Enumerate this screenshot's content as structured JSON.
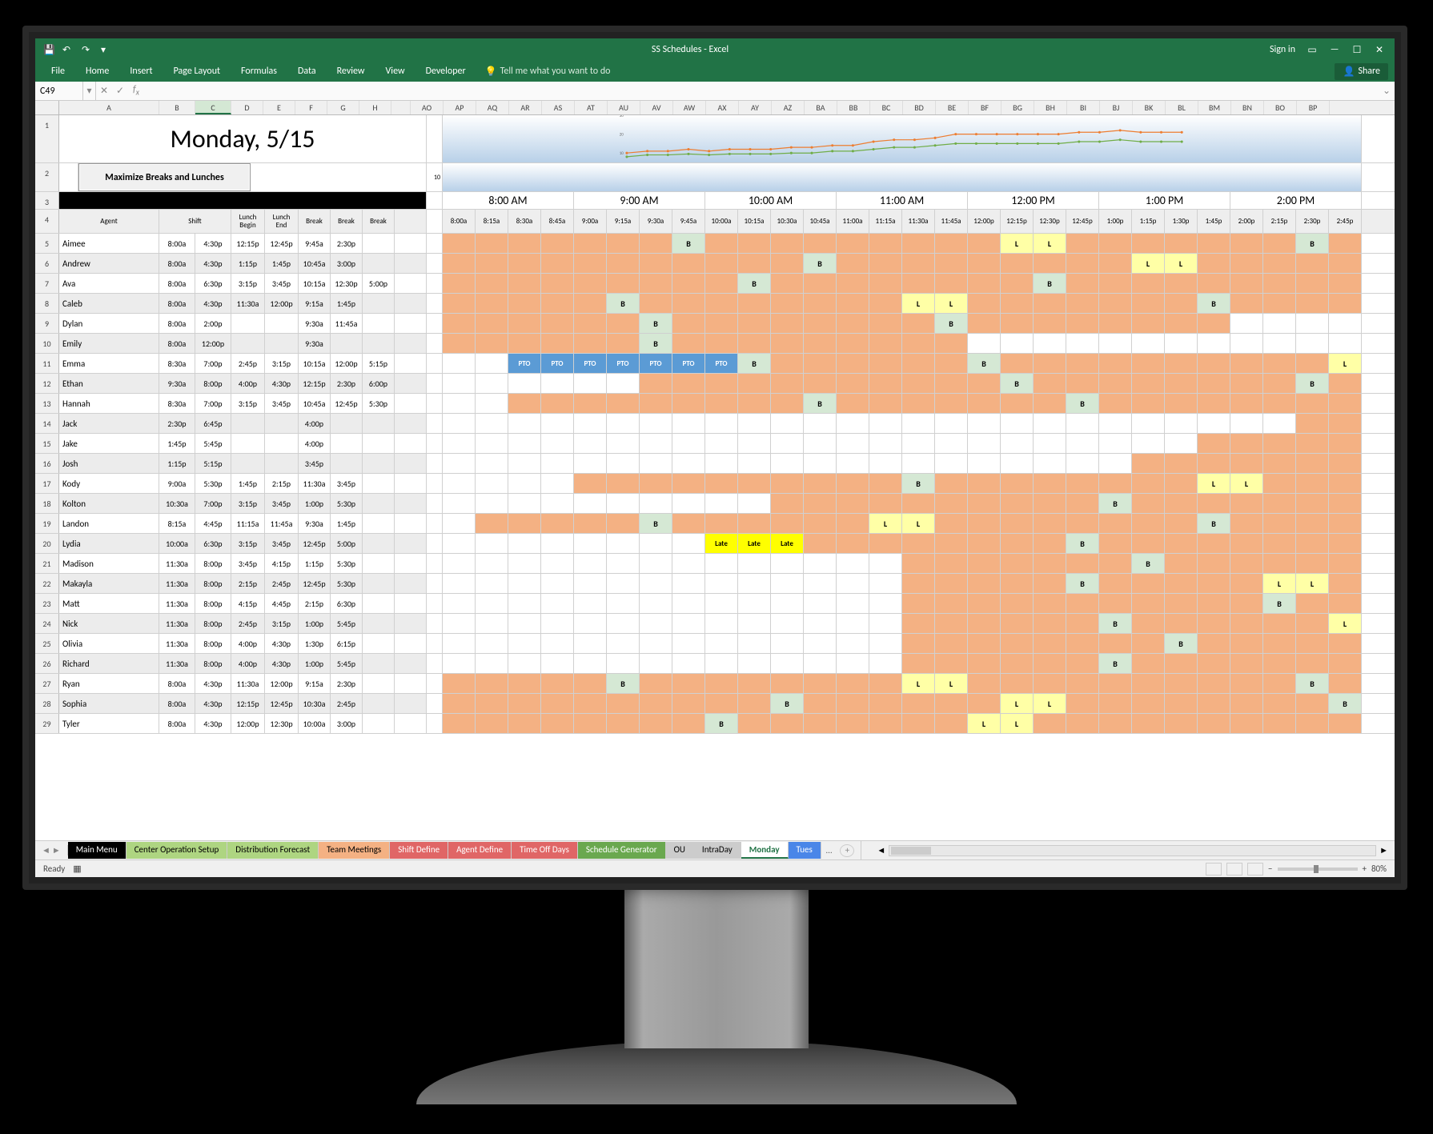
{
  "app": {
    "title": "SS Schedules - Excel",
    "sign_in": "Sign in",
    "share": "Share",
    "tell_me": "Tell me what you want to do"
  },
  "ribbon": {
    "tabs": [
      "File",
      "Home",
      "Insert",
      "Page Layout",
      "Formulas",
      "Data",
      "Review",
      "View",
      "Developer"
    ]
  },
  "name_box": "C49",
  "status": {
    "ready": "Ready",
    "zoom": "80%"
  },
  "columns_left": [
    "A",
    "B",
    "C",
    "D",
    "E",
    "F",
    "G",
    "H"
  ],
  "columns_right": [
    "AO",
    "AP",
    "AQ",
    "AR",
    "AS",
    "AT",
    "AU",
    "AV",
    "AW",
    "AX",
    "AY",
    "AZ",
    "BA",
    "BB",
    "BC",
    "BD",
    "BE",
    "BF",
    "BG",
    "BH",
    "BI",
    "BJ",
    "BK",
    "BL",
    "BM",
    "BN",
    "BO",
    "BP"
  ],
  "date_title": "Monday, 5/15",
  "maximize_btn": "Maximize Breaks and Lunches",
  "hour_headers": [
    "8:00 AM",
    "9:00 AM",
    "10:00 AM",
    "11:00 AM",
    "12:00 PM",
    "1:00 PM",
    "2:00 PM"
  ],
  "sub_headers_left": [
    "Agent",
    "Shift",
    "Lunch Begin",
    "Lunch End",
    "Break",
    "Break",
    "Break"
  ],
  "time_slots": [
    "8:00a",
    "8:15a",
    "8:30a",
    "8:45a",
    "9:00a",
    "9:15a",
    "9:30a",
    "9:45a",
    "10:00a",
    "10:15a",
    "10:30a",
    "10:45a",
    "11:00a",
    "11:15a",
    "11:30a",
    "11:45a",
    "12:00p",
    "12:15p",
    "12:30p",
    "12:45p",
    "1:00p",
    "1:15p",
    "1:30p",
    "1:45p",
    "2:00p",
    "2:15p",
    "2:30p",
    "2:45p"
  ],
  "agents": [
    {
      "n": 5,
      "name": "Aimee",
      "shift": [
        "8:00a",
        "4:30p"
      ],
      "lunch": [
        "12:15p",
        "12:45p"
      ],
      "breaks": [
        "9:45a",
        "2:30p",
        ""
      ],
      "slots": {
        "0": "s",
        "1": "s",
        "2": "s",
        "3": "s",
        "4": "s",
        "5": "s",
        "6": "s",
        "7": "B",
        "8": "s",
        "9": "s",
        "10": "s",
        "11": "s",
        "12": "s",
        "13": "s",
        "14": "s",
        "15": "s",
        "16": "s",
        "17": "L",
        "18": "L",
        "19": "s",
        "20": "s",
        "21": "s",
        "22": "s",
        "23": "s",
        "24": "s",
        "25": "s",
        "26": "B",
        "27": "s"
      }
    },
    {
      "n": 6,
      "name": "Andrew",
      "shift": [
        "8:00a",
        "4:30p"
      ],
      "lunch": [
        "1:15p",
        "1:45p"
      ],
      "breaks": [
        "10:45a",
        "3:00p",
        ""
      ],
      "slots": {
        "0": "s",
        "1": "s",
        "2": "s",
        "3": "s",
        "4": "s",
        "5": "s",
        "6": "s",
        "7": "s",
        "8": "s",
        "9": "s",
        "10": "s",
        "11": "B",
        "12": "s",
        "13": "s",
        "14": "s",
        "15": "s",
        "16": "s",
        "17": "s",
        "18": "s",
        "19": "s",
        "20": "s",
        "21": "L",
        "22": "L",
        "23": "s",
        "24": "s",
        "25": "s",
        "26": "s",
        "27": "s"
      }
    },
    {
      "n": 7,
      "name": "Ava",
      "shift": [
        "8:00a",
        "6:30p"
      ],
      "lunch": [
        "3:15p",
        "3:45p"
      ],
      "breaks": [
        "10:15a",
        "12:30p",
        "5:00p"
      ],
      "slots": {
        "0": "s",
        "1": "s",
        "2": "s",
        "3": "s",
        "4": "s",
        "5": "s",
        "6": "s",
        "7": "s",
        "8": "s",
        "9": "B",
        "10": "s",
        "11": "s",
        "12": "s",
        "13": "s",
        "14": "s",
        "15": "s",
        "16": "s",
        "17": "s",
        "18": "B",
        "19": "s",
        "20": "s",
        "21": "s",
        "22": "s",
        "23": "s",
        "24": "s",
        "25": "s",
        "26": "s",
        "27": "s"
      }
    },
    {
      "n": 8,
      "name": "Caleb",
      "shift": [
        "8:00a",
        "4:30p"
      ],
      "lunch": [
        "11:30a",
        "12:00p"
      ],
      "breaks": [
        "9:15a",
        "1:45p",
        ""
      ],
      "slots": {
        "0": "s",
        "1": "s",
        "2": "s",
        "3": "s",
        "4": "s",
        "5": "B",
        "6": "s",
        "7": "s",
        "8": "s",
        "9": "s",
        "10": "s",
        "11": "s",
        "12": "s",
        "13": "s",
        "14": "L",
        "15": "L",
        "16": "s",
        "17": "s",
        "18": "s",
        "19": "s",
        "20": "s",
        "21": "s",
        "22": "s",
        "23": "B",
        "24": "s",
        "25": "s",
        "26": "s",
        "27": "s"
      }
    },
    {
      "n": 9,
      "name": "Dylan",
      "shift": [
        "8:00a",
        "2:00p"
      ],
      "lunch": [
        "",
        ""
      ],
      "breaks": [
        "9:30a",
        "11:45a",
        ""
      ],
      "slots": {
        "0": "s",
        "1": "s",
        "2": "s",
        "3": "s",
        "4": "s",
        "5": "s",
        "6": "B",
        "7": "s",
        "8": "s",
        "9": "s",
        "10": "s",
        "11": "s",
        "12": "s",
        "13": "s",
        "14": "s",
        "15": "B",
        "16": "s",
        "17": "s",
        "18": "s",
        "19": "s",
        "20": "s",
        "21": "s",
        "22": "s",
        "23": "s"
      }
    },
    {
      "n": 10,
      "name": "Emily",
      "shift": [
        "8:00a",
        "12:00p"
      ],
      "lunch": [
        "",
        ""
      ],
      "breaks": [
        "9:30a",
        "",
        ""
      ],
      "slots": {
        "0": "s",
        "1": "s",
        "2": "s",
        "3": "s",
        "4": "s",
        "5": "s",
        "6": "B",
        "7": "s",
        "8": "s",
        "9": "s",
        "10": "s",
        "11": "s",
        "12": "s",
        "13": "s",
        "14": "s",
        "15": "s"
      }
    },
    {
      "n": 11,
      "name": "Emma",
      "shift": [
        "8:30a",
        "7:00p"
      ],
      "lunch": [
        "2:45p",
        "3:15p"
      ],
      "breaks": [
        "10:15a",
        "12:00p",
        "5:15p"
      ],
      "slots": {
        "2": "PTO",
        "3": "PTO",
        "4": "PTO",
        "5": "PTO",
        "6": "PTO",
        "7": "PTO",
        "8": "PTO",
        "9": "B",
        "10": "s",
        "11": "s",
        "12": "s",
        "13": "s",
        "14": "s",
        "15": "s",
        "16": "B",
        "17": "s",
        "18": "s",
        "19": "s",
        "20": "s",
        "21": "s",
        "22": "s",
        "23": "s",
        "24": "s",
        "25": "s",
        "26": "s",
        "27": "L"
      }
    },
    {
      "n": 12,
      "name": "Ethan",
      "shift": [
        "9:30a",
        "8:00p"
      ],
      "lunch": [
        "4:00p",
        "4:30p"
      ],
      "breaks": [
        "12:15p",
        "2:30p",
        "6:00p"
      ],
      "slots": {
        "6": "s",
        "7": "s",
        "8": "s",
        "9": "s",
        "10": "s",
        "11": "s",
        "12": "s",
        "13": "s",
        "14": "s",
        "15": "s",
        "16": "s",
        "17": "B",
        "18": "s",
        "19": "s",
        "20": "s",
        "21": "s",
        "22": "s",
        "23": "s",
        "24": "s",
        "25": "s",
        "26": "B",
        "27": "s"
      }
    },
    {
      "n": 13,
      "name": "Hannah",
      "shift": [
        "8:30a",
        "7:00p"
      ],
      "lunch": [
        "3:15p",
        "3:45p"
      ],
      "breaks": [
        "10:45a",
        "12:45p",
        "5:30p"
      ],
      "slots": {
        "2": "s",
        "3": "s",
        "4": "s",
        "5": "s",
        "6": "s",
        "7": "s",
        "8": "s",
        "9": "s",
        "10": "s",
        "11": "B",
        "12": "s",
        "13": "s",
        "14": "s",
        "15": "s",
        "16": "s",
        "17": "s",
        "18": "s",
        "19": "B",
        "20": "s",
        "21": "s",
        "22": "s",
        "23": "s",
        "24": "s",
        "25": "s",
        "26": "s",
        "27": "s"
      }
    },
    {
      "n": 14,
      "name": "Jack",
      "shift": [
        "2:30p",
        "6:45p"
      ],
      "lunch": [
        "",
        ""
      ],
      "breaks": [
        "4:00p",
        "",
        ""
      ],
      "slots": {
        "26": "s",
        "27": "s"
      }
    },
    {
      "n": 15,
      "name": "Jake",
      "shift": [
        "1:45p",
        "5:45p"
      ],
      "lunch": [
        "",
        ""
      ],
      "breaks": [
        "4:00p",
        "",
        ""
      ],
      "slots": {
        "23": "s",
        "24": "s",
        "25": "s",
        "26": "s",
        "27": "s"
      }
    },
    {
      "n": 16,
      "name": "Josh",
      "shift": [
        "1:15p",
        "5:15p"
      ],
      "lunch": [
        "",
        ""
      ],
      "breaks": [
        "3:45p",
        "",
        ""
      ],
      "slots": {
        "21": "s",
        "22": "s",
        "23": "s",
        "24": "s",
        "25": "s",
        "26": "s",
        "27": "s"
      }
    },
    {
      "n": 17,
      "name": "Kody",
      "shift": [
        "9:00a",
        "5:30p"
      ],
      "lunch": [
        "1:45p",
        "2:15p"
      ],
      "breaks": [
        "11:30a",
        "3:45p",
        ""
      ],
      "slots": {
        "4": "s",
        "5": "s",
        "6": "s",
        "7": "s",
        "8": "s",
        "9": "s",
        "10": "s",
        "11": "s",
        "12": "s",
        "13": "s",
        "14": "B",
        "15": "s",
        "16": "s",
        "17": "s",
        "18": "s",
        "19": "s",
        "20": "s",
        "21": "s",
        "22": "s",
        "23": "L",
        "24": "L",
        "25": "s",
        "26": "s",
        "27": "s"
      }
    },
    {
      "n": 18,
      "name": "Kolton",
      "shift": [
        "10:30a",
        "7:00p"
      ],
      "lunch": [
        "3:15p",
        "3:45p"
      ],
      "breaks": [
        "1:00p",
        "5:30p",
        ""
      ],
      "slots": {
        "10": "s",
        "11": "s",
        "12": "s",
        "13": "s",
        "14": "s",
        "15": "s",
        "16": "s",
        "17": "s",
        "18": "s",
        "19": "s",
        "20": "B",
        "21": "s",
        "22": "s",
        "23": "s",
        "24": "s",
        "25": "s",
        "26": "s",
        "27": "s"
      }
    },
    {
      "n": 19,
      "name": "Landon",
      "shift": [
        "8:15a",
        "4:45p"
      ],
      "lunch": [
        "11:15a",
        "11:45a"
      ],
      "breaks": [
        "9:30a",
        "1:45p",
        ""
      ],
      "slots": {
        "1": "s",
        "2": "s",
        "3": "s",
        "4": "s",
        "5": "s",
        "6": "B",
        "7": "s",
        "8": "s",
        "9": "s",
        "10": "s",
        "11": "s",
        "12": "s",
        "13": "L",
        "14": "L",
        "15": "s",
        "16": "s",
        "17": "s",
        "18": "s",
        "19": "s",
        "20": "s",
        "21": "s",
        "22": "s",
        "23": "B",
        "24": "s",
        "25": "s",
        "26": "s",
        "27": "s"
      }
    },
    {
      "n": 20,
      "name": "Lydia",
      "shift": [
        "10:00a",
        "6:30p"
      ],
      "lunch": [
        "3:15p",
        "3:45p"
      ],
      "breaks": [
        "12:45p",
        "5:00p",
        ""
      ],
      "slots": {
        "8": "Late",
        "9": "Late",
        "10": "Late",
        "11": "s",
        "12": "s",
        "13": "s",
        "14": "s",
        "15": "s",
        "16": "s",
        "17": "s",
        "18": "s",
        "19": "B",
        "20": "s",
        "21": "s",
        "22": "s",
        "23": "s",
        "24": "s",
        "25": "s",
        "26": "s",
        "27": "s"
      }
    },
    {
      "n": 21,
      "name": "Madison",
      "shift": [
        "11:30a",
        "8:00p"
      ],
      "lunch": [
        "3:45p",
        "4:15p"
      ],
      "breaks": [
        "1:15p",
        "5:30p",
        ""
      ],
      "slots": {
        "14": "s",
        "15": "s",
        "16": "s",
        "17": "s",
        "18": "s",
        "19": "s",
        "20": "s",
        "21": "B",
        "22": "s",
        "23": "s",
        "24": "s",
        "25": "s",
        "26": "s",
        "27": "s"
      }
    },
    {
      "n": 22,
      "name": "Makayla",
      "shift": [
        "11:30a",
        "8:00p"
      ],
      "lunch": [
        "2:15p",
        "2:45p"
      ],
      "breaks": [
        "12:45p",
        "5:30p",
        ""
      ],
      "slots": {
        "14": "s",
        "15": "s",
        "16": "s",
        "17": "s",
        "18": "s",
        "19": "B",
        "20": "s",
        "21": "s",
        "22": "s",
        "23": "s",
        "24": "s",
        "25": "L",
        "26": "L",
        "27": "s"
      }
    },
    {
      "n": 23,
      "name": "Matt",
      "shift": [
        "11:30a",
        "8:00p"
      ],
      "lunch": [
        "4:15p",
        "4:45p"
      ],
      "breaks": [
        "2:15p",
        "6:30p",
        ""
      ],
      "slots": {
        "14": "s",
        "15": "s",
        "16": "s",
        "17": "s",
        "18": "s",
        "19": "s",
        "20": "s",
        "21": "s",
        "22": "s",
        "23": "s",
        "24": "s",
        "25": "B",
        "26": "s",
        "27": "s"
      }
    },
    {
      "n": 24,
      "name": "Nick",
      "shift": [
        "11:30a",
        "8:00p"
      ],
      "lunch": [
        "2:45p",
        "3:15p"
      ],
      "breaks": [
        "1:00p",
        "5:45p",
        ""
      ],
      "slots": {
        "14": "s",
        "15": "s",
        "16": "s",
        "17": "s",
        "18": "s",
        "19": "s",
        "20": "B",
        "21": "s",
        "22": "s",
        "23": "s",
        "24": "s",
        "25": "s",
        "26": "s",
        "27": "L"
      }
    },
    {
      "n": 25,
      "name": "Olivia",
      "shift": [
        "11:30a",
        "8:00p"
      ],
      "lunch": [
        "4:00p",
        "4:30p"
      ],
      "breaks": [
        "1:30p",
        "6:15p",
        ""
      ],
      "slots": {
        "14": "s",
        "15": "s",
        "16": "s",
        "17": "s",
        "18": "s",
        "19": "s",
        "20": "s",
        "21": "s",
        "22": "B",
        "23": "s",
        "24": "s",
        "25": "s",
        "26": "s",
        "27": "s"
      }
    },
    {
      "n": 26,
      "name": "Richard",
      "shift": [
        "11:30a",
        "8:00p"
      ],
      "lunch": [
        "4:00p",
        "4:30p"
      ],
      "breaks": [
        "1:00p",
        "5:45p",
        ""
      ],
      "slots": {
        "14": "s",
        "15": "s",
        "16": "s",
        "17": "s",
        "18": "s",
        "19": "s",
        "20": "B",
        "21": "s",
        "22": "s",
        "23": "s",
        "24": "s",
        "25": "s",
        "26": "s",
        "27": "s"
      }
    },
    {
      "n": 27,
      "name": "Ryan",
      "shift": [
        "8:00a",
        "4:30p"
      ],
      "lunch": [
        "11:30a",
        "12:00p"
      ],
      "breaks": [
        "9:15a",
        "2:30p",
        ""
      ],
      "slots": {
        "0": "s",
        "1": "s",
        "2": "s",
        "3": "s",
        "4": "s",
        "5": "B",
        "6": "s",
        "7": "s",
        "8": "s",
        "9": "s",
        "10": "s",
        "11": "s",
        "12": "s",
        "13": "s",
        "14": "L",
        "15": "L",
        "16": "s",
        "17": "s",
        "18": "s",
        "19": "s",
        "20": "s",
        "21": "s",
        "22": "s",
        "23": "s",
        "24": "s",
        "25": "s",
        "26": "B",
        "27": "s"
      }
    },
    {
      "n": 28,
      "name": "Sophia",
      "shift": [
        "8:00a",
        "4:30p"
      ],
      "lunch": [
        "12:15p",
        "12:45p"
      ],
      "breaks": [
        "10:30a",
        "2:45p",
        ""
      ],
      "slots": {
        "0": "s",
        "1": "s",
        "2": "s",
        "3": "s",
        "4": "s",
        "5": "s",
        "6": "s",
        "7": "s",
        "8": "s",
        "9": "s",
        "10": "B",
        "11": "s",
        "12": "s",
        "13": "s",
        "14": "s",
        "15": "s",
        "16": "s",
        "17": "L",
        "18": "L",
        "19": "s",
        "20": "s",
        "21": "s",
        "22": "s",
        "23": "s",
        "24": "s",
        "25": "s",
        "26": "s",
        "27": "B"
      }
    },
    {
      "n": 29,
      "name": "Tyler",
      "shift": [
        "8:00a",
        "4:30p"
      ],
      "lunch": [
        "12:00p",
        "12:30p"
      ],
      "breaks": [
        "10:00a",
        "3:00p",
        ""
      ],
      "slots": {
        "0": "s",
        "1": "s",
        "2": "s",
        "3": "s",
        "4": "s",
        "5": "s",
        "6": "s",
        "7": "s",
        "8": "B",
        "9": "s",
        "10": "s",
        "11": "s",
        "12": "s",
        "13": "s",
        "14": "s",
        "15": "s",
        "16": "L",
        "17": "L",
        "18": "s",
        "19": "s",
        "20": "s",
        "21": "s",
        "22": "s",
        "23": "s",
        "24": "s",
        "25": "s",
        "26": "s",
        "27": "s"
      }
    }
  ],
  "sheet_tabs": [
    {
      "label": "Main Menu",
      "cls": "tab-black"
    },
    {
      "label": "Center Operation Setup",
      "cls": "tab-green"
    },
    {
      "label": "Distribution Forecast",
      "cls": "tab-green"
    },
    {
      "label": "Team Meetings",
      "cls": "tab-orange"
    },
    {
      "label": "Shift Define",
      "cls": "tab-red"
    },
    {
      "label": "Agent Define",
      "cls": "tab-red"
    },
    {
      "label": "Time Off Days",
      "cls": "tab-red"
    },
    {
      "label": "Schedule Generator",
      "cls": "tab-dkgreen"
    },
    {
      "label": "OU",
      "cls": "tab-gray"
    },
    {
      "label": "IntraDay",
      "cls": "tab-gray"
    },
    {
      "label": "Monday",
      "cls": "tab-active"
    },
    {
      "label": "Tues",
      "cls": "tab-blue"
    }
  ],
  "chart_data": {
    "type": "line",
    "title": "",
    "xlabel": "",
    "ylabel": "",
    "y_ticks": [
      10,
      20,
      30
    ],
    "ylim": [
      5,
      30
    ],
    "x": [
      0,
      1,
      2,
      3,
      4,
      5,
      6,
      7,
      8,
      9,
      10,
      11,
      12,
      13,
      14,
      15,
      16,
      17,
      18,
      19,
      20,
      21,
      22,
      23,
      24,
      25,
      26,
      27
    ],
    "series": [
      {
        "name": "orange",
        "color": "#ed7d31",
        "values": [
          10,
          11,
          11,
          12,
          11,
          12,
          12,
          12,
          13,
          13,
          14,
          14,
          16,
          17,
          17,
          18,
          20,
          20,
          20,
          20,
          20,
          20,
          21,
          21,
          22,
          21,
          21,
          21
        ]
      },
      {
        "name": "green",
        "color": "#70ad47",
        "values": [
          8,
          9,
          9,
          9.5,
          9,
          9.5,
          9.5,
          9.5,
          10,
          10,
          11,
          11,
          12,
          13,
          13,
          14,
          15,
          15,
          15,
          15,
          15,
          15,
          16,
          16,
          17,
          16,
          16,
          16
        ]
      }
    ]
  }
}
